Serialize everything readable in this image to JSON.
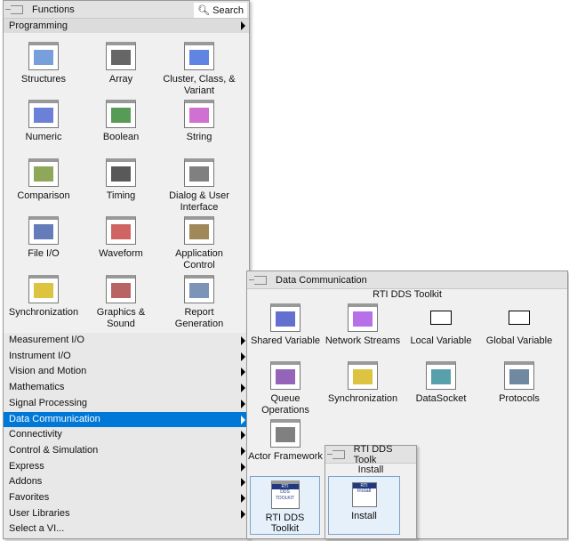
{
  "functions": {
    "title": "Functions",
    "search_label": "Search",
    "section": "Programming",
    "items": [
      {
        "label": "Structures",
        "icon": "structures-icon",
        "color": "#4a7fd0"
      },
      {
        "label": "Array",
        "icon": "array-icon",
        "color": "#333333"
      },
      {
        "label": "Cluster, Class, & Variant",
        "icon": "cluster-icon",
        "color": "#2a5bd7"
      },
      {
        "label": "Numeric",
        "icon": "numeric-icon",
        "color": "#3a56c8"
      },
      {
        "label": "Boolean",
        "icon": "boolean-icon",
        "color": "#1e7a1e"
      },
      {
        "label": "String",
        "icon": "string-icon",
        "color": "#c040c0"
      },
      {
        "label": "Comparison",
        "icon": "comparison-icon",
        "color": "#6a8a20"
      },
      {
        "label": "Timing",
        "icon": "timing-icon",
        "color": "#222222"
      },
      {
        "label": "Dialog & User Interface",
        "icon": "dialog-icon",
        "color": "#555555"
      },
      {
        "label": "File I/O",
        "icon": "file-io-icon",
        "color": "#3050a0"
      },
      {
        "label": "Waveform",
        "icon": "waveform-icon",
        "color": "#c03030"
      },
      {
        "label": "Application Control",
        "icon": "app-control-icon",
        "color": "#806020"
      },
      {
        "label": "Synchronization",
        "icon": "synchronization-icon",
        "color": "#d0b000"
      },
      {
        "label": "Graphics & Sound",
        "icon": "graphics-sound-icon",
        "color": "#a03030"
      },
      {
        "label": "Report Generation",
        "icon": "report-icon",
        "color": "#5070a0"
      }
    ],
    "categories": [
      "Measurement I/O",
      "Instrument I/O",
      "Vision and Motion",
      "Mathematics",
      "Signal Processing",
      "Data Communication",
      "Connectivity",
      "Control & Simulation",
      "Express",
      "Addons",
      "Favorites",
      "User Libraries",
      "Select a VI..."
    ],
    "selected_category": "Data Communication"
  },
  "data_comm": {
    "title": "Data Communication",
    "section": "RTI DDS Toolkit",
    "items": [
      {
        "label": "Shared Variable",
        "icon": "shared-variable-icon",
        "color": "#3040c0"
      },
      {
        "label": "Network Streams",
        "icon": "network-streams-icon",
        "color": "#a040e0"
      },
      {
        "label": "Local Variable",
        "icon": "local-variable-icon",
        "color": "#000000"
      },
      {
        "label": "Global Variable",
        "icon": "global-variable-icon",
        "color": "#000000"
      },
      {
        "label": "Queue Operations",
        "icon": "queue-icon",
        "color": "#7030a0"
      },
      {
        "label": "Synchronization",
        "icon": "synchronization-icon",
        "color": "#d0b000"
      },
      {
        "label": "DataSocket",
        "icon": "datasocket-icon",
        "color": "#208090"
      },
      {
        "label": "Protocols",
        "icon": "protocols-icon",
        "color": "#406080"
      },
      {
        "label": "Actor Framework",
        "icon": "gear-icon",
        "color": "#555555"
      }
    ],
    "selected": {
      "label": "RTI DDS Toolkit",
      "icon_text": [
        "RTI",
        "DDS TOOLKIT"
      ]
    }
  },
  "rti": {
    "title": "RTI DDS Toolk",
    "section": "Install",
    "item": {
      "label": "Install",
      "icon_text": [
        "RTI",
        "Install"
      ]
    }
  }
}
